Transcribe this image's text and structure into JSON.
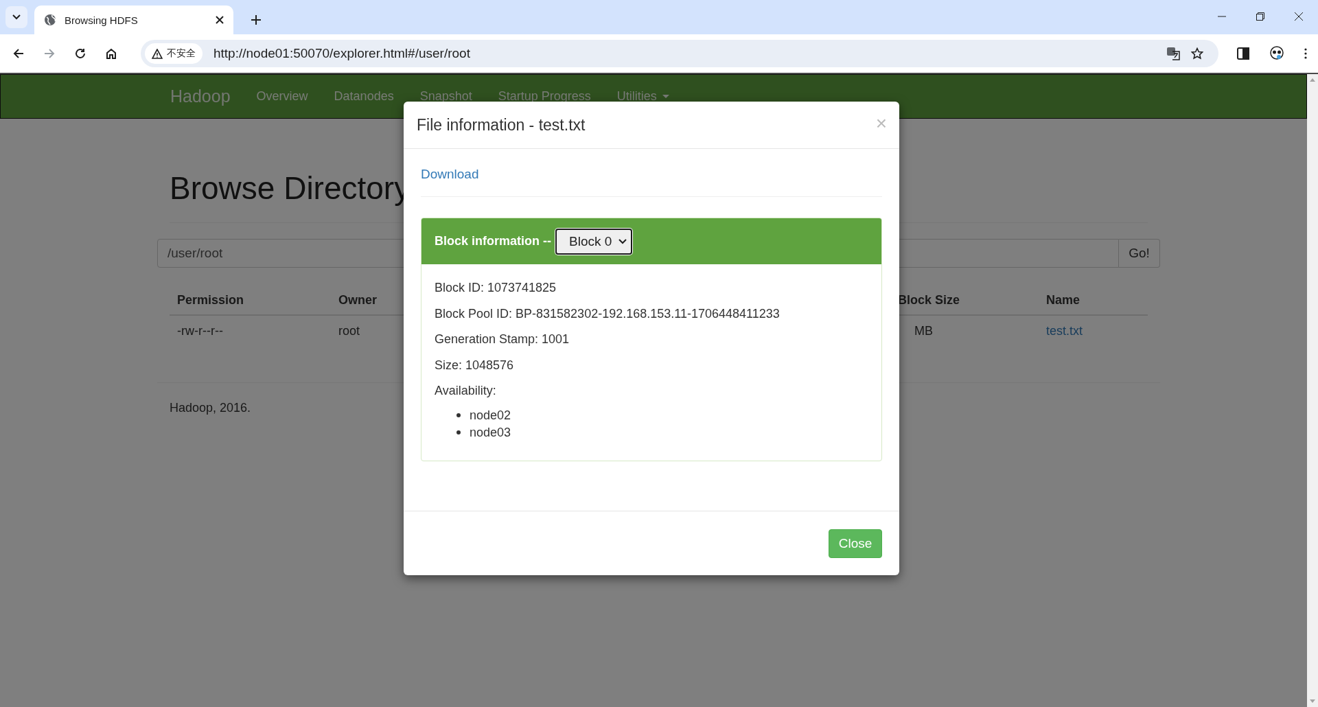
{
  "browser": {
    "tabs": [
      {
        "title": "Browsing HDFS",
        "selected": true
      }
    ],
    "address": {
      "security_label": "不安全",
      "url": "http://node01:50070/explorer.html#/user/root"
    }
  },
  "navbar": {
    "brand": "Hadoop",
    "items": [
      {
        "label": "Overview",
        "dropdown": false
      },
      {
        "label": "Datanodes",
        "dropdown": false
      },
      {
        "label": "Snapshot",
        "dropdown": false
      },
      {
        "label": "Startup Progress",
        "dropdown": false
      },
      {
        "label": "Utilities",
        "dropdown": true
      }
    ]
  },
  "page": {
    "heading": "Browse Directory",
    "path_field": {
      "value": "/user/root"
    },
    "go_button": "Go!",
    "table": {
      "columns": [
        {
          "label": "Permission"
        },
        {
          "label": "Owner"
        },
        {
          "label": "Block Size"
        },
        {
          "label": "Name"
        }
      ],
      "rows": [
        {
          "cells": [
            {
              "text": "-rw-r--r--",
              "kind": "text"
            },
            {
              "text": "root",
              "kind": "text"
            },
            {
              "text": "MB",
              "kind": "text"
            },
            {
              "text": "test.txt",
              "kind": "link"
            }
          ]
        }
      ]
    },
    "footer": "Hadoop, 2016."
  },
  "modal": {
    "title": "File information - test.txt",
    "close_glyph": "×",
    "download_link": "Download",
    "block_panel": {
      "label": "Block information --",
      "select": {
        "value": "Block 0"
      },
      "fields": [
        "Block ID: 1073741825",
        "Block Pool ID: BP-831582302-192.168.153.11-1706448411233",
        "Generation Stamp: 1001",
        "Size: 1048576"
      ],
      "availability_label": "Availability:",
      "nodes": [
        "node02",
        "node03"
      ]
    },
    "close_button": "Close"
  }
}
